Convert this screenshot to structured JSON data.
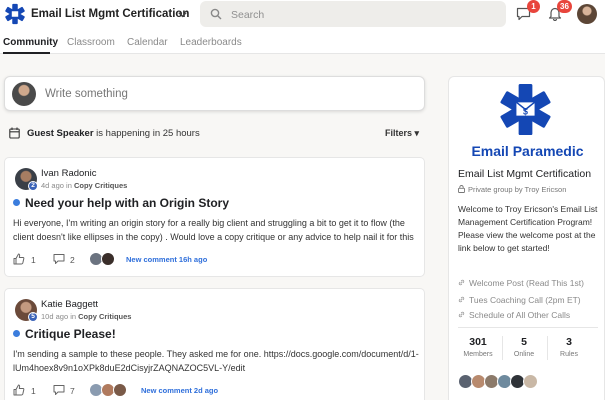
{
  "header": {
    "group_name": "Email List Mgmt Certification",
    "search_placeholder": "Search",
    "chat_badge": "1",
    "notifications_badge": "36"
  },
  "tabs": [
    {
      "label": "Community",
      "active": true
    },
    {
      "label": "Classroom",
      "active": false
    },
    {
      "label": "Calendar",
      "active": false
    },
    {
      "label": "Leaderboards",
      "active": false
    }
  ],
  "composer": {
    "placeholder": "Write something"
  },
  "event": {
    "name": "Guest Speaker",
    "suffix": " is happening in 25 hours",
    "filters_label": "Filters"
  },
  "posts": [
    {
      "author": "Ivan Radonic",
      "level": "2",
      "time": "4d ago in ",
      "category": "Copy Critiques",
      "title": "Need your help with an Origin Story",
      "body": "Hi everyone, I'm writing an origin story for a really big client and struggling a bit to get it to flow (the client doesn't like ellipses in the copy) . Would love a copy critique or any advice to help nail it for this",
      "likes": "1",
      "comments": "2",
      "new_comment": "New comment 16h ago"
    },
    {
      "author": "Katie Baggett",
      "level": "5",
      "time": "10d ago in ",
      "category": "Copy Critiques",
      "title": "Critique Please!",
      "body": "I'm sending a sample to these people. They asked me for one. https://docs.google.com/document/d/1-lUm4hoex8v9n1oXPk8duE2dCisyjrZAQNAZOC5VL-Y/edit",
      "likes": "1",
      "comments": "7",
      "new_comment": "New comment 2d ago"
    }
  ],
  "sidebar": {
    "brand": "Email Paramedic",
    "group_name": "Email List Mgmt Certification",
    "privacy": "Private group by Troy Ericson",
    "description": "Welcome to Troy Ericson's Email List Management Certification Program! Please view the welcome post at the link below to get started!",
    "links": [
      "Welcome Post (Read This 1st)",
      "Tues Coaching Call (2pm ET)",
      "Schedule of All Other Calls"
    ],
    "stats": [
      {
        "value": "301",
        "label": "Members"
      },
      {
        "value": "5",
        "label": "Online"
      },
      {
        "value": "3",
        "label": "Rules"
      }
    ]
  },
  "colors": {
    "accent_blue": "#1447b4",
    "link_blue": "#2f6fdb",
    "badge_red": "#e8453c"
  }
}
